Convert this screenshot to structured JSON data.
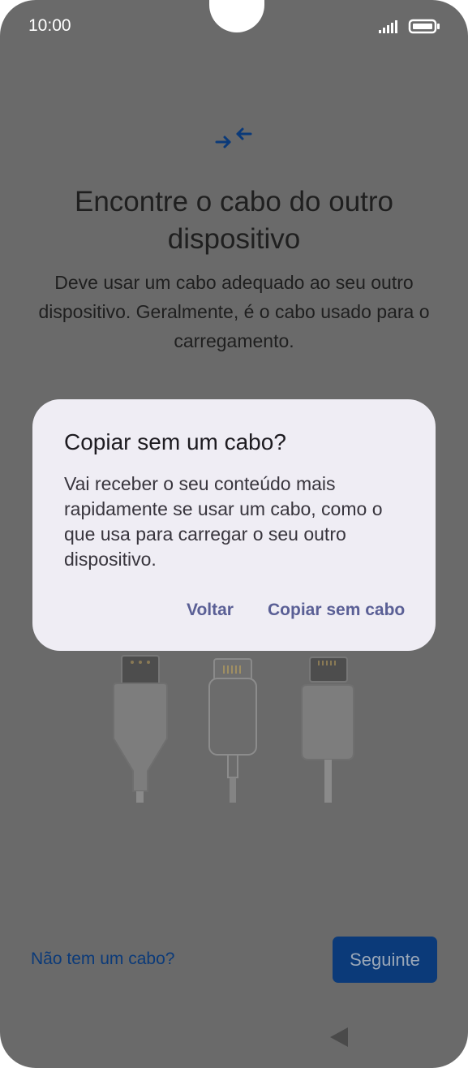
{
  "status_bar": {
    "time": "10:00"
  },
  "setup": {
    "icon": "transfer-arrows-icon",
    "title": "Encontre o cabo do outro dispositivo",
    "subtitle": "Deve usar um cabo adequado ao seu outro dispositivo. Geralmente, é o cabo usado para o carregamento.",
    "no_cable_link": "Não tem um cabo?",
    "next_button": "Seguinte"
  },
  "dialog": {
    "title": "Copiar sem um cabo?",
    "body": "Vai receber o seu conteúdo mais rapidamente se usar um cabo, como o que usa para carregar o seu outro dispositivo.",
    "back_button": "Voltar",
    "copy_button": "Copiar sem cabo"
  },
  "colors": {
    "accent": "#0b3a79",
    "dialog_background": "#efedf4",
    "dialog_button": "#5a5f95",
    "scrim": "#6a6a6a"
  }
}
